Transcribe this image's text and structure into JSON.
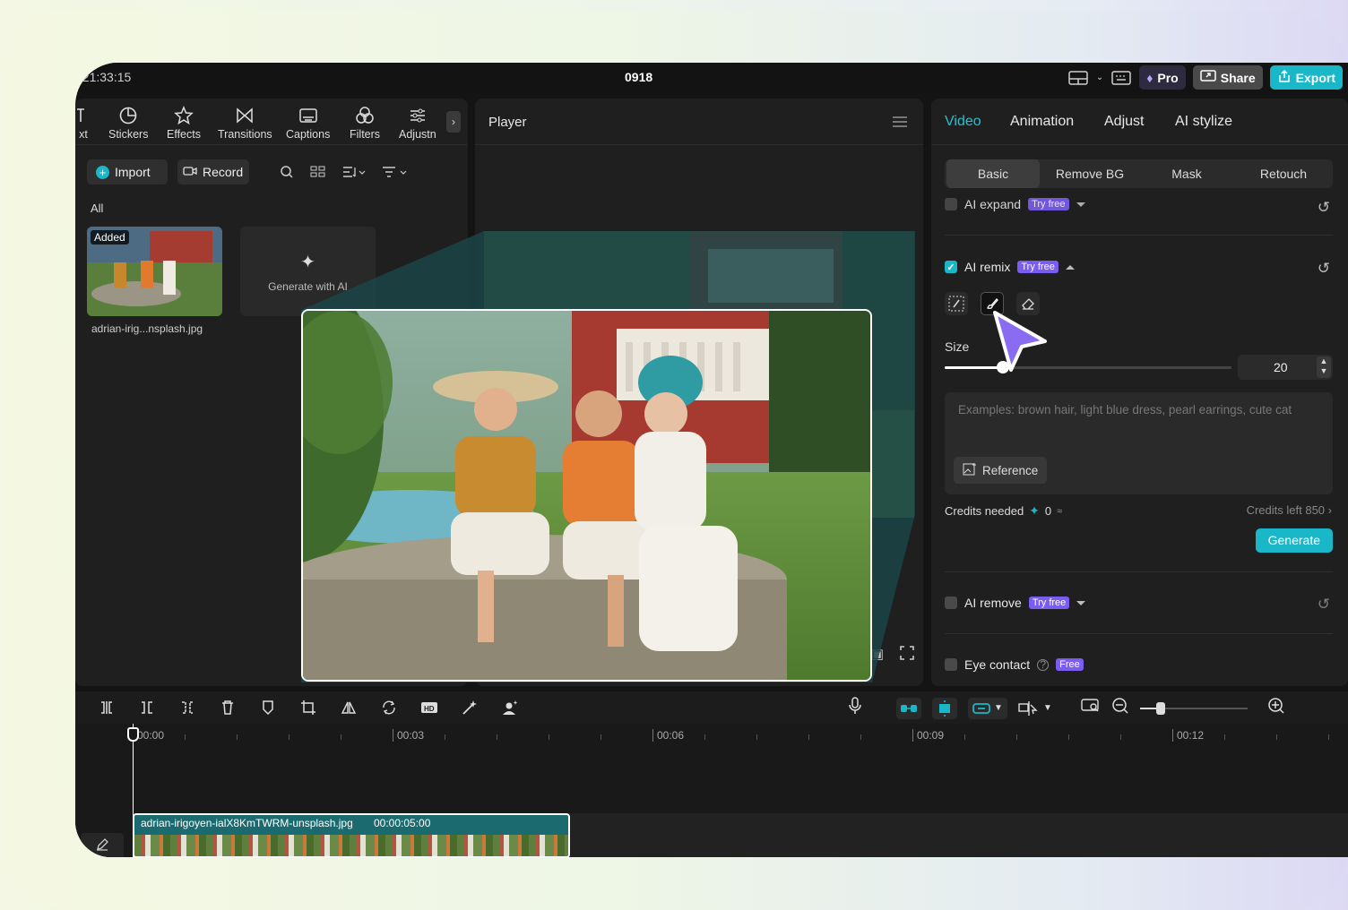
{
  "top_bar": {
    "timecode": ": 21:33:15",
    "project_title": "0918",
    "pro_label": "Pro",
    "share_label": "Share",
    "export_label": "Export"
  },
  "media_toolbar": {
    "items": [
      {
        "label": "xt",
        "icon": "text-icon"
      },
      {
        "label": "Stickers",
        "icon": "sticker-icon"
      },
      {
        "label": "Effects",
        "icon": "effects-star-icon"
      },
      {
        "label": "Transitions",
        "icon": "transition-icon"
      },
      {
        "label": "Captions",
        "icon": "captions-icon"
      },
      {
        "label": "Filters",
        "icon": "filters-icon"
      },
      {
        "label": "Adjustn",
        "icon": "adjust-sliders-icon"
      }
    ]
  },
  "media_panel": {
    "import_label": "Import",
    "record_label": "Record",
    "filter_all": "All",
    "thumb_badge": "Added",
    "thumb_name": "adrian-irig...nsplash.jpg",
    "generate_label": "Generate with AI"
  },
  "player": {
    "title": "Player"
  },
  "properties": {
    "tabs": [
      "Video",
      "Animation",
      "Adjust",
      "AI stylize"
    ],
    "active_tab": "Video",
    "sub_tabs": [
      "Basic",
      "Remove BG",
      "Mask",
      "Retouch"
    ],
    "active_sub_tab": "Basic",
    "ai_expand": {
      "label": "AI expand",
      "badge": "Try free"
    },
    "ai_remix": {
      "label": "AI remix",
      "badge": "Try free",
      "checked": true
    },
    "size_label": "Size",
    "size_value": "20",
    "size_fraction": 0.2,
    "prompt_placeholder": "Examples: brown hair, light blue dress, pearl earrings, cute cat",
    "reference_label": "Reference",
    "credits_needed_label": "Credits needed",
    "credits_needed_value": "0",
    "credits_left": "Credits left 850",
    "generate_label": "Generate",
    "ai_remove": {
      "label": "AI remove",
      "badge": "Try free"
    },
    "eye_contact": {
      "label": "Eye contact",
      "badge": "Free"
    }
  },
  "timeline": {
    "ticks": [
      "00:00",
      "00:03",
      "00:06",
      "00:09",
      "00:12"
    ],
    "clip_name": "adrian-irigoyen-ialX8KmTWRM-unsplash.jpg",
    "clip_duration": "00:00:05:00"
  },
  "colors": {
    "accent": "#1ab7c8",
    "badge": "#7b5cf0",
    "cursor": "#8a6cf2"
  }
}
